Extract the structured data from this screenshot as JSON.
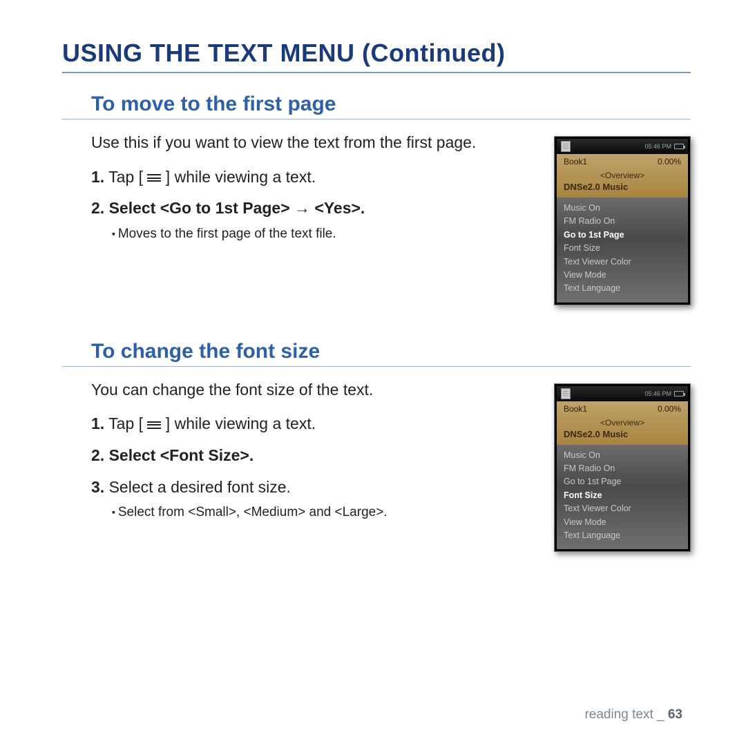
{
  "page": {
    "title": "USING THE TEXT MENU (Continued)",
    "footer_label": "reading text _ ",
    "footer_page": "63"
  },
  "section1": {
    "heading": "To move to the first page",
    "intro": "Use this if you want to view the text from the first page.",
    "step1_num": "1.",
    "step1_a": " Tap [ ",
    "step1_b": " ] while viewing a text.",
    "step2_num": "2.",
    "step2_text": " Select <Go to 1st Page> → <Yes>.",
    "note": "Moves to the first page of the text file."
  },
  "section2": {
    "heading": "To change the font size",
    "intro": "You can change the font size of the text.",
    "step1_num": "1.",
    "step1_a": " Tap [ ",
    "step1_b": " ] while viewing a text.",
    "step2_num": "2.",
    "step2_text": " Select <Font Size>.",
    "step3_num": "3.",
    "step3_text": " Select a desired font size.",
    "note": "Select from <Small>, <Medium> and <Large>."
  },
  "device": {
    "time": "05:46 PM",
    "book": "Book1",
    "pct": "0.00%",
    "overview": "<Overview>",
    "dnse": "DNSe2.0 Music",
    "menu": {
      "m1": "Music On",
      "m2": "FM Radio On",
      "m3": "Go to 1st Page",
      "m4": "Font Size",
      "m5": "Text Viewer Color",
      "m6": "View Mode",
      "m7": "Text Language"
    }
  }
}
